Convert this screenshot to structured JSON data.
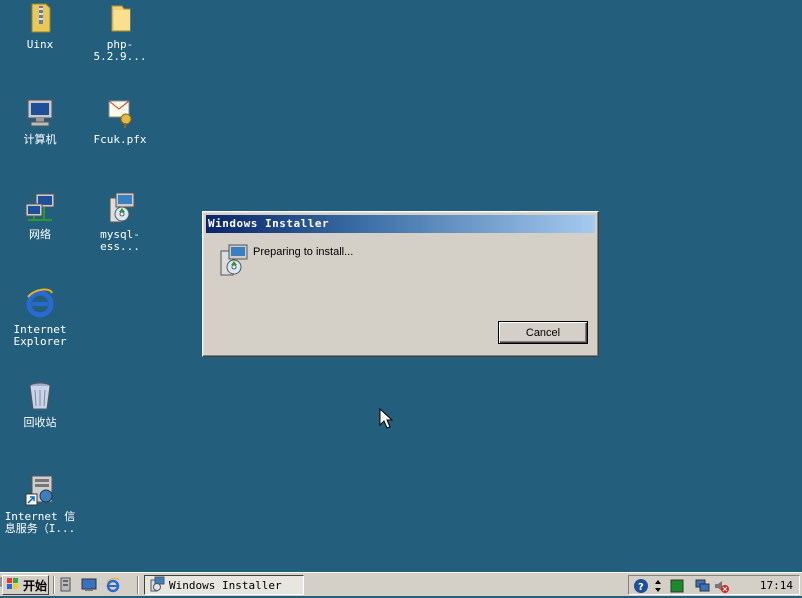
{
  "desktop": {
    "icons": [
      {
        "label": "Uinx",
        "icon": "folder-zip-icon"
      },
      {
        "label": "php-5.2.9...",
        "icon": "folder-icon"
      },
      {
        "label": "计算机",
        "icon": "computer-icon"
      },
      {
        "label": "Fcuk.pfx",
        "icon": "certificate-icon"
      },
      {
        "label": "网络",
        "icon": "network-icon"
      },
      {
        "label": "mysql-ess...",
        "icon": "installer-icon"
      },
      {
        "label": "Internet\nExplorer",
        "icon": "internet-explorer-icon"
      },
      {
        "label": "回收站",
        "icon": "recycle-bin-icon"
      },
      {
        "label": "Internet 信\n息服务（I...",
        "icon": "iis-shortcut-icon"
      }
    ]
  },
  "dialog": {
    "title": "Windows Installer",
    "message": "Preparing to install...",
    "cancel_label": "Cancel"
  },
  "taskbar": {
    "start_label": "开始",
    "task_label": "Windows Installer",
    "clock": "17:14"
  },
  "colors": {
    "desktop": "#235f7d",
    "title_start": "#0a246a",
    "title_end": "#a6caf0",
    "chrome": "#d4d0c8"
  }
}
